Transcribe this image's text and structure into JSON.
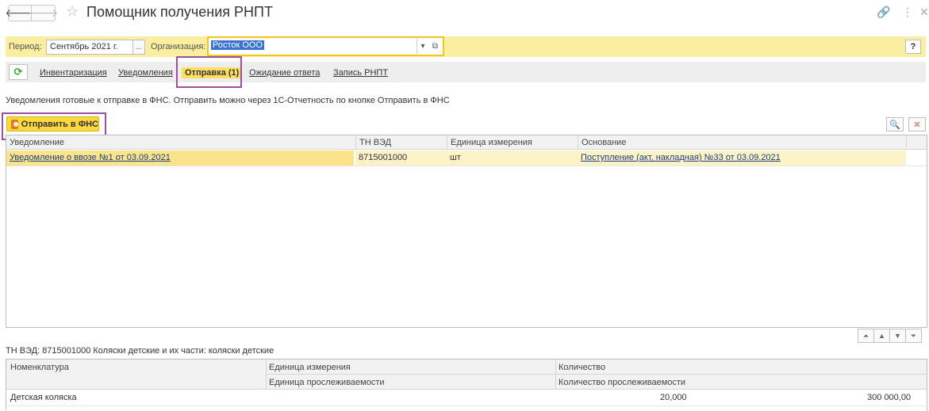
{
  "window": {
    "title": "Помощник получения РНПТ",
    "back_glyph": "🡐",
    "forward_glyph": "🡒",
    "star_glyph": "☆",
    "link_glyph": "🔗",
    "more_glyph": "⋮",
    "close_glyph": "✕"
  },
  "filters": {
    "period_label": "Период:",
    "period_value": "Сентябрь 2021 г.",
    "period_btn": "...",
    "org_label": "Организация:",
    "org_value": "Росток ООО",
    "dropdown_glyph": "▾",
    "open_glyph": "⧉",
    "help_label": "?"
  },
  "tabs": {
    "refresh_glyph": "⟳",
    "items": [
      {
        "label": "Инвентаризация"
      },
      {
        "label": "Уведомления"
      },
      {
        "label": "Отправка (1)"
      },
      {
        "label": "Ожидание ответа"
      },
      {
        "label": "Запись РНПТ"
      }
    ]
  },
  "info_text": "Уведомления готовые к отправке в ФНС. Отправить можно через 1С-Отчетность по кнопке Отправить в ФНС",
  "send_button": "Отправить в ФНС",
  "tools": {
    "search_glyph": "🔍",
    "clear_glyph": "✖"
  },
  "table1": {
    "headers": [
      "Уведомление",
      "ТН ВЭД",
      "Единица измерения",
      "Основание"
    ],
    "rows": [
      {
        "notice": "Уведомление о ввозе №1 от 03.09.2021",
        "tnved": "8715001000",
        "unit": "шт",
        "basis": "Поступление (акт, накладная) №33 от 03.09.2021"
      }
    ]
  },
  "scroll": {
    "first": "⏶",
    "up": "▲",
    "down": "▼",
    "last": "⏷"
  },
  "tnved_line": "ТН ВЭД: 8715001000 Коляски детские и их части: коляски детские",
  "table2": {
    "headers": {
      "nomenclature": "Номенклатура",
      "unit": "Единица измерения",
      "trace_unit": "Единица прослеживаемости",
      "qty": "Количество",
      "trace_qty": "Количество прослеживаемости"
    },
    "rows": [
      {
        "name": "Детская коляска",
        "qty": "20,000",
        "amount": "300 000,00"
      }
    ]
  },
  "colors": {
    "accent_yellow": "#f9d93d",
    "highlight_frame": "#9b4f9f",
    "selection_blue": "#3a73d2",
    "link_blue": "#1a3e7d"
  }
}
